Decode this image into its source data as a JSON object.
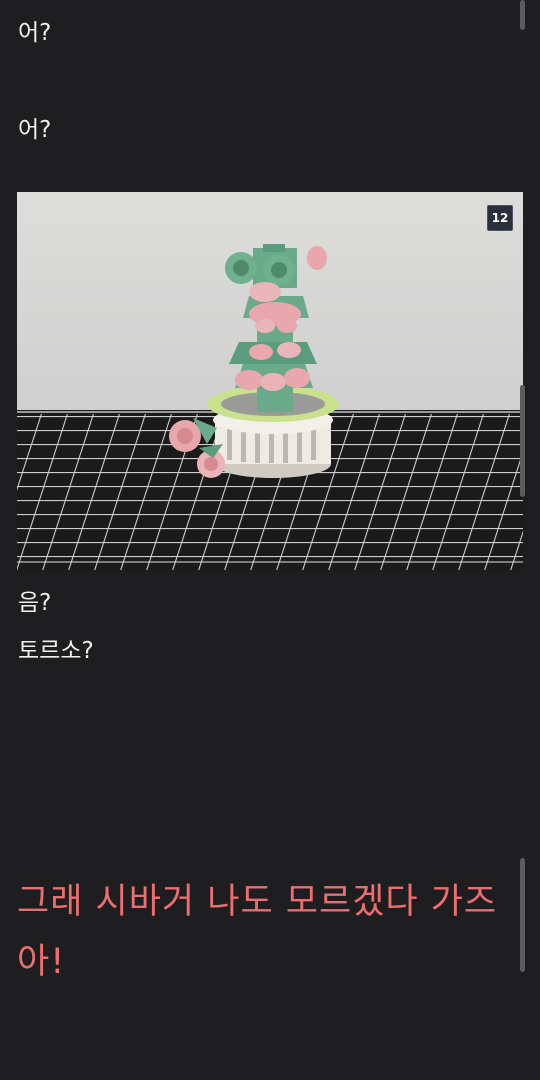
{
  "post": {
    "lines": [
      "어?",
      "어?",
      "음?",
      "토르소?"
    ],
    "punchline": "그래 시바거 나도 모르겠다 가즈아!"
  },
  "photo": {
    "badge": "12",
    "subject": "lego-flower-torso-on-round-stand",
    "colors": {
      "wall": "#d9d9d9",
      "mat": "#1b1b1b",
      "grid": "#d6d6d6",
      "brick_green": "#6aa98a",
      "brick_pink": "#e7a7ad",
      "stand_white": "#eeeae4",
      "ring_lime": "#c9e08d"
    }
  },
  "theme": {
    "background": "#1e1e20",
    "text": "#f2f2f2",
    "accent": "#ec6f6f"
  }
}
